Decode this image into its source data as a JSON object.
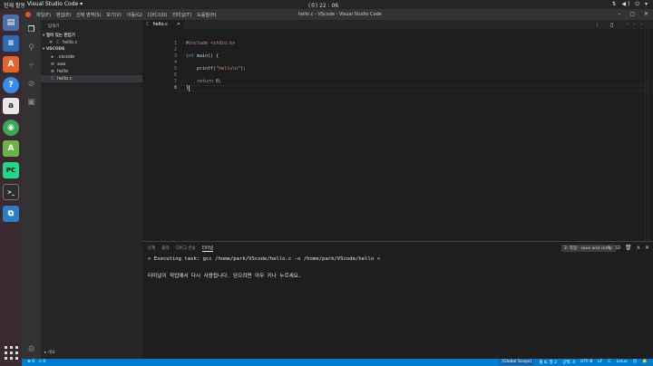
{
  "os_bar": {
    "activities": "현재 활동",
    "app_name": "Visual Studio Code ▾",
    "clock": "(수) 22 : 06",
    "tray": "⇅ ◀) ⏻ ▾"
  },
  "dock": {
    "items": [
      {
        "name": "files",
        "glyph": "▤",
        "color": "#4c6fa8"
      },
      {
        "name": "writer",
        "glyph": "≡",
        "color": "#2b6bb3"
      },
      {
        "name": "software",
        "glyph": "A",
        "color": "#e3642f"
      },
      {
        "name": "help",
        "glyph": "?",
        "color": "#3b8ee8"
      },
      {
        "name": "amazon",
        "glyph": "a",
        "color": "#e8e8e8"
      },
      {
        "name": "chrome",
        "glyph": "◉",
        "color": "#3aa757"
      },
      {
        "name": "android-studio",
        "glyph": "A",
        "color": "#6ab344"
      },
      {
        "name": "pycharm",
        "glyph": "PC",
        "color": "#21d789"
      },
      {
        "name": "terminal",
        "glyph": ">_",
        "color": "#2e2e2e"
      },
      {
        "name": "vscode",
        "glyph": "⧉",
        "color": "#2b7dc8"
      }
    ]
  },
  "window": {
    "title": "hello.c - VScode - Visual Studio Code",
    "menu": [
      "파일(F)",
      "편집(E)",
      "선택 영역(S)",
      "보기(V)",
      "이동(G)",
      "디버그(D)",
      "터미널(T)",
      "도움말(H)"
    ],
    "controls": [
      "–",
      "▢",
      "✕"
    ]
  },
  "sidebar": {
    "title": "탐색기",
    "open_editors_header": "▾ 열려 있는 편집기",
    "open_editors": [
      {
        "close": "✕",
        "icon": "C",
        "label": "hello.c"
      }
    ],
    "project_header": "▾ VSCODE",
    "files": [
      {
        "icon": "▸",
        "label": ".vscode",
        "selected": false
      },
      {
        "icon": "≡",
        "label": "aaa",
        "selected": false
      },
      {
        "icon": "≡",
        "label": "hello",
        "selected": false
      },
      {
        "icon": "C",
        "label": "hello.c",
        "selected": true
      }
    ],
    "outline": "▸ 개요"
  },
  "editor": {
    "tab_label": "hello.c",
    "tab_icon": "C",
    "actions": "⫶ ▯ ···",
    "line_numbers": [
      "1",
      "2",
      "3",
      "4",
      "5",
      "6",
      "7",
      "8"
    ],
    "lines": {
      "l1_directive": "#include ",
      "l1_header": "<stdio.h>",
      "l3_type": "int",
      "l3_rest": " main() {",
      "l5_fn": "printf",
      "l5_open": "(",
      "l5_str": "\"hello\\n\"",
      "l5_close": ");",
      "l7_kw": "return",
      "l7_num": "0",
      "l7_end": ";",
      "l8": "}"
    }
  },
  "panel": {
    "tabs": [
      "문제",
      "출력",
      "디버그 콘솔",
      "터미널"
    ],
    "active_tab": "터미널",
    "terminal_select": "2: 작업 - save and comp",
    "actions": [
      "+",
      "⊟",
      "🗑",
      "∧",
      "✕"
    ],
    "line1": "> Executing task: gcc /home/park/VScode/hello.c -o /home/park/VScode/hello <",
    "line2": "터미널이 작업에서 다시 사용됩니다. 닫으려면 아무 키나 누르세요."
  },
  "status": {
    "errors": "⊗ 0",
    "warnings": "⚠ 0",
    "scope": "[Global Scope]",
    "position": "줄 8, 열 2",
    "spaces": "공백: 4",
    "encoding": "UTF-8",
    "eol": "LF",
    "language": "C",
    "platform": "Linux",
    "feedback": "☺",
    "bell": "🔔"
  }
}
